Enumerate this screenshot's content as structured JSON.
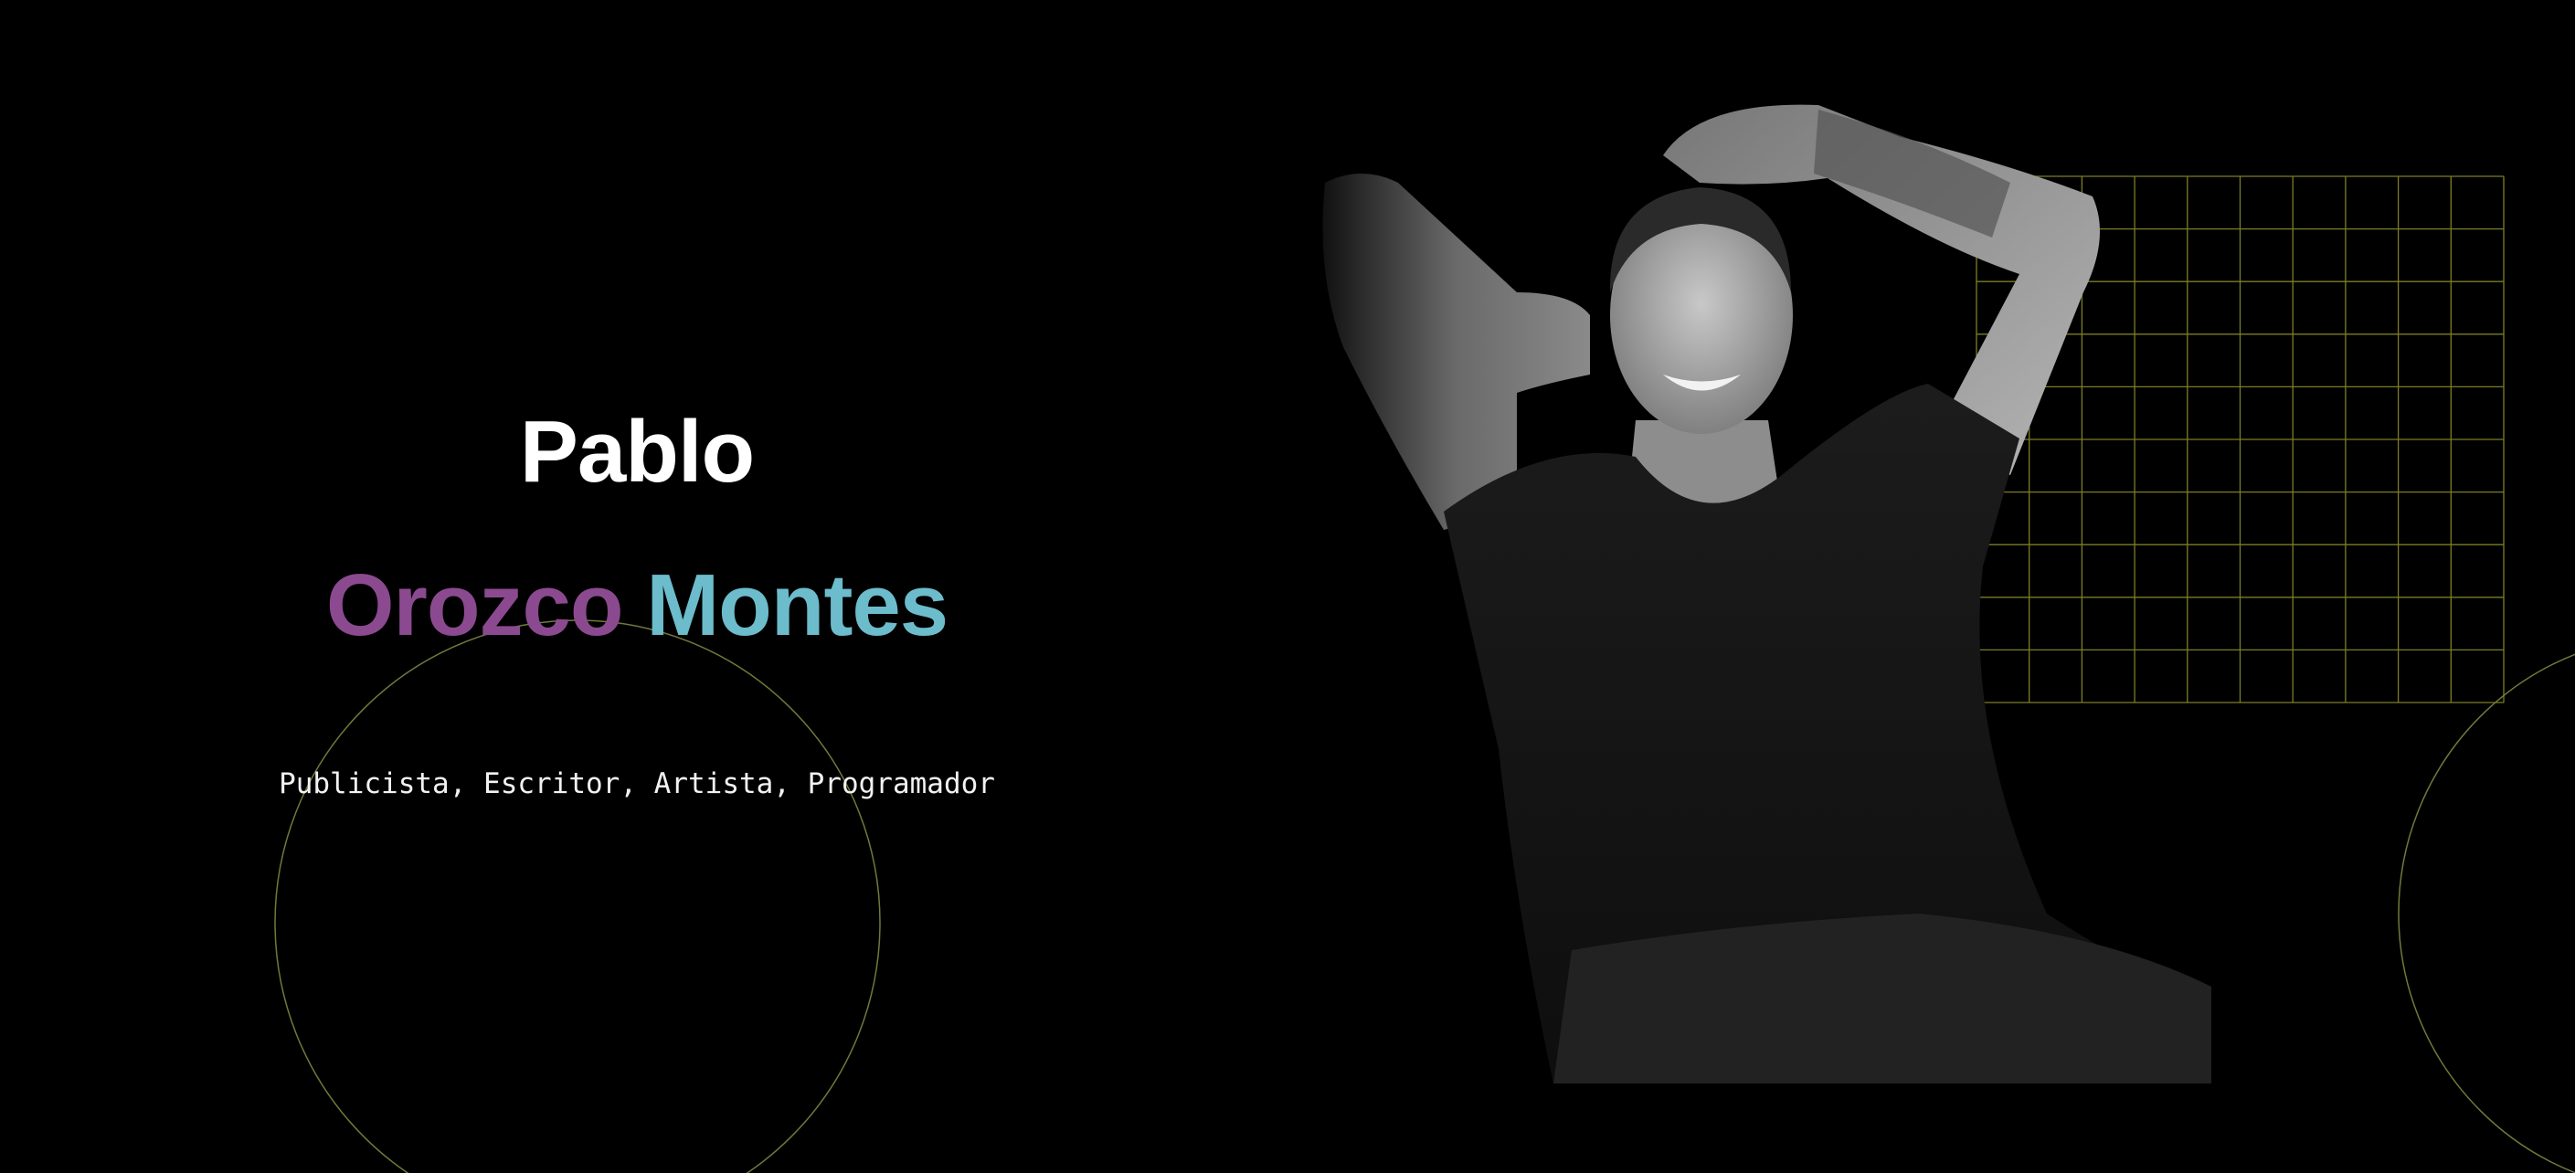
{
  "hero": {
    "first_name": "Pablo",
    "last_name_1": "Orozco",
    "last_name_2": "Montes",
    "roles": "Publicista, Escritor, Artista, Programador"
  },
  "colors": {
    "background": "#000000",
    "accent_purple": "#8b4a90",
    "accent_cyan": "#6cbccc",
    "line_green": "#6f7a3a",
    "grid_yellow": "#8a8a2a"
  },
  "image": {
    "description_icon": "portrait-photo-grayscale"
  }
}
